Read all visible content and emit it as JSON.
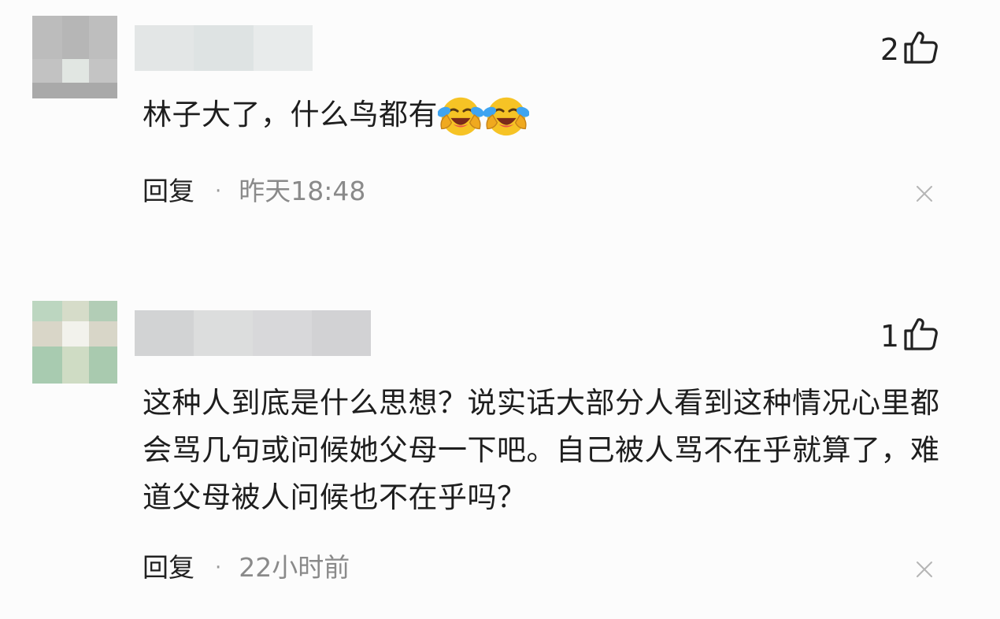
{
  "comments": [
    {
      "like_count": "2",
      "text": "林子大了，什么鸟都有",
      "emojis": [
        "laughing-crying-emoji",
        "laughing-crying-emoji"
      ],
      "reply_label": "回复",
      "separator": "·",
      "time": "昨天18:48",
      "avatar_colors": [
        "#bcbcbc",
        "#b6b6b6",
        "#bebebe",
        "#c2c2c2",
        "#e1e6e2",
        "#c4c4c4",
        "#a9a9a9",
        "#a9a9a9",
        "#a9a9a9"
      ],
      "name_blur_colors": [
        "#e3e6e6",
        "#dee3e3",
        "#e8ebeb"
      ]
    },
    {
      "like_count": "1",
      "text": "这种人到底是什么思想？说实话大部分人看到这种情况心里都会骂几句或问候她父母一下吧。自己被人骂不在乎就算了，难道父母被人问候也不在乎吗？",
      "emojis": [],
      "reply_label": "回复",
      "separator": "·",
      "time": "22小时前",
      "avatar_colors": [
        "#bcd6c0",
        "#d6dcc9",
        "#b2cdb6",
        "#d9d6c8",
        "#f2f2ec",
        "#d8d6c8",
        "#a8cbb0",
        "#cfdcc4",
        "#a9caaf"
      ],
      "name_blur_colors": [
        "#d2d3d4",
        "#dcdddd",
        "#d8d8da",
        "#d2d2d4"
      ]
    }
  ],
  "watermark": "",
  "colors": {
    "background": "#fcfcfc",
    "text": "#1e1e1e",
    "meta_time": "#8a8a8a",
    "emoji_face": "#f6c325",
    "emoji_tears": "#3fa4f0"
  },
  "icons": {
    "like": "thumbs-up-icon",
    "close": "close-icon"
  }
}
